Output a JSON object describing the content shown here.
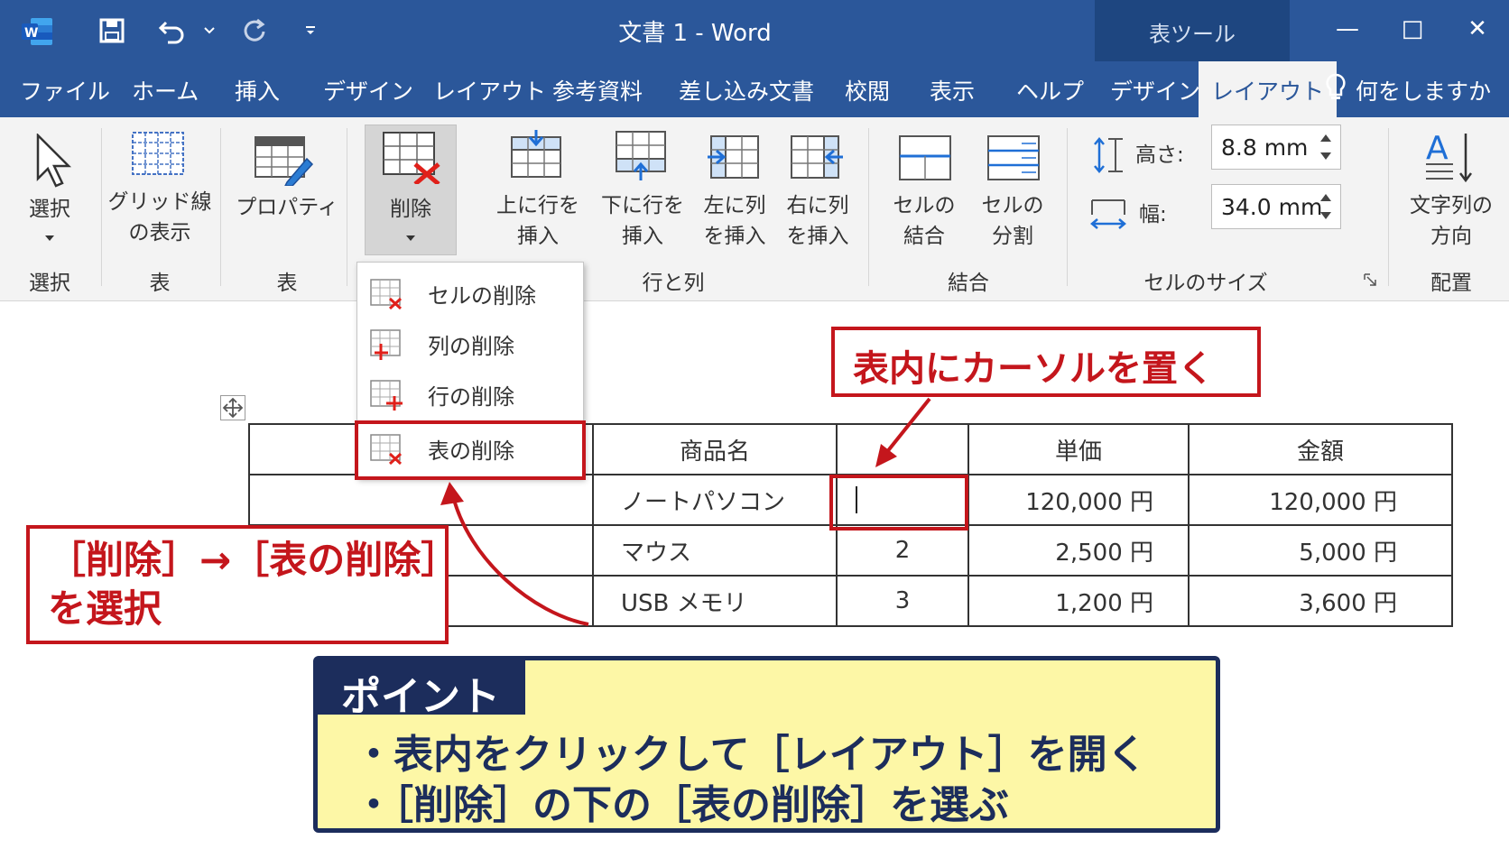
{
  "titlebar": {
    "doc_title": "文書 1  -  Word",
    "context_title": "表ツール",
    "minimize": "—",
    "maximize": "□",
    "close": "✕"
  },
  "tabs": {
    "items": [
      "ファイル",
      "ホーム",
      "挿入",
      "デザイン",
      "レイアウト",
      "参考資料",
      "差し込み文書",
      "校閲",
      "表示",
      "ヘルプ"
    ],
    "context_items": [
      "デザイン",
      "レイアウト"
    ],
    "active": "レイアウト",
    "tell_me": "何をしますか"
  },
  "ribbon": {
    "select_label": "選択",
    "gridlines_label_1": "グリッド線",
    "gridlines_label_2": "の表示",
    "properties_label": "プロパティ",
    "delete_label": "削除",
    "insert_above_1": "上に行を",
    "insert_above_2": "挿入",
    "insert_below_1": "下に行を",
    "insert_below_2": "挿入",
    "insert_left_1": "左に列",
    "insert_left_2": "を挿入",
    "insert_right_1": "右に列",
    "insert_right_2": "を挿入",
    "merge_1": "セルの",
    "merge_2": "結合",
    "split_1": "セルの",
    "split_2": "分割",
    "height_label": "高さ:",
    "height_value": "8.8 mm",
    "width_label": "幅:",
    "width_value": "34.0 mm",
    "text_dir_1": "文字列の",
    "text_dir_2": "方向",
    "groups": {
      "select": "選択",
      "table1": "表",
      "table2": "表",
      "rows_cols": "行と列",
      "merge": "結合",
      "cell_size": "セルのサイズ",
      "alignment": "配置"
    }
  },
  "dropdown": {
    "items": [
      "セルの削除",
      "列の削除",
      "行の削除",
      "表の削除"
    ]
  },
  "table": {
    "header": [
      "商品名",
      "",
      "単価",
      "金額"
    ],
    "rows": [
      [
        "ノートパソコン",
        "",
        "120,000 円",
        "120,000 円"
      ],
      [
        "マウス",
        "2",
        "2,500 円",
        "5,000 円"
      ],
      [
        "USB メモリ",
        "3",
        "1,200 円",
        "3,600 円"
      ]
    ]
  },
  "callouts": {
    "cursor_note": "表内にカーソルを置く",
    "delete_note_1": "［削除］→［表の削除］",
    "delete_note_2": "を選択"
  },
  "point": {
    "title": "ポイント",
    "line1": "・表内をクリックして［レイアウト］を開く",
    "line2": "・［削除］の下の［表の削除］を選ぶ"
  },
  "colors": {
    "word_blue": "#2b579a",
    "context_blue": "#1e4680",
    "callout_red": "#c4161c",
    "point_navy": "#1c2d5c",
    "point_yellow": "#fdf7a6"
  }
}
